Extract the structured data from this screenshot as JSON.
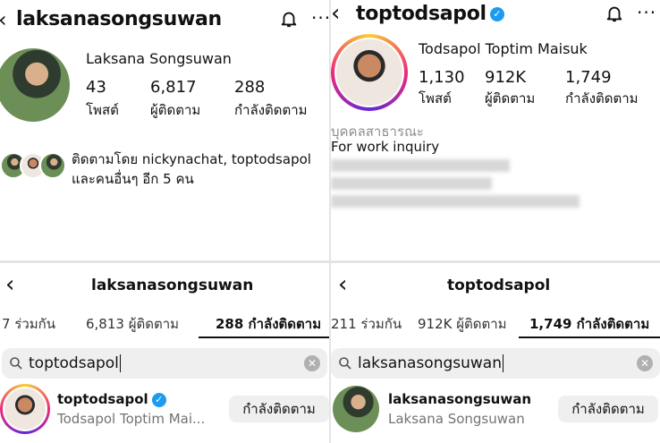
{
  "top_left": {
    "username": "laksanasongsuwan",
    "full_name": "Laksana Songsuwan",
    "stats": [
      {
        "num": "43",
        "label": "โพสต์"
      },
      {
        "num": "6,817",
        "label": "ผู้ติดตาม"
      },
      {
        "num": "288",
        "label": "กำลังติดตาม"
      }
    ],
    "followed_by_line1": "ติดตามโดย nickynachat, toptodsapol",
    "followed_by_line2": "และคนอื่นๆ อีก 5 คน"
  },
  "top_right": {
    "username": "toptodsapol",
    "full_name": "Todsapol Toptim Maisuk",
    "stats": [
      {
        "num": "1,130",
        "label": "โพสต์"
      },
      {
        "num": "912K",
        "label": "ผู้ติดตาม"
      },
      {
        "num": "1,749",
        "label": "กำลังติดตาม"
      }
    ],
    "category": "บุคคลสาธารณะ",
    "bio": "For work inquiry"
  },
  "bottom_left": {
    "title": "laksanasongsuwan",
    "tab_mutual": "7 ร่วมกัน",
    "tab_followers": "6,813 ผู้ติดตาม",
    "tab_following": "288 กำลังติดตาม",
    "search_value": "toptodsapol",
    "result_username": "toptodsapol",
    "result_name": "Todsapol Toptim Mai...",
    "result_button": "กำลังติดตาม"
  },
  "bottom_right": {
    "title": "toptodsapol",
    "tab_mutual": "211 ร่วมกัน",
    "tab_followers": "912K ผู้ติดตาม",
    "tab_following": "1,749 กำลังติดตาม",
    "search_value": "laksanasongsuwan",
    "result_username": "laksanasongsuwan",
    "result_name": "Laksana Songsuwan",
    "result_button": "กำลังติดตาม"
  },
  "colors": {
    "verified": "#1d9bf0",
    "search_bg": "#efefef",
    "divider": "#dbdbdb"
  }
}
